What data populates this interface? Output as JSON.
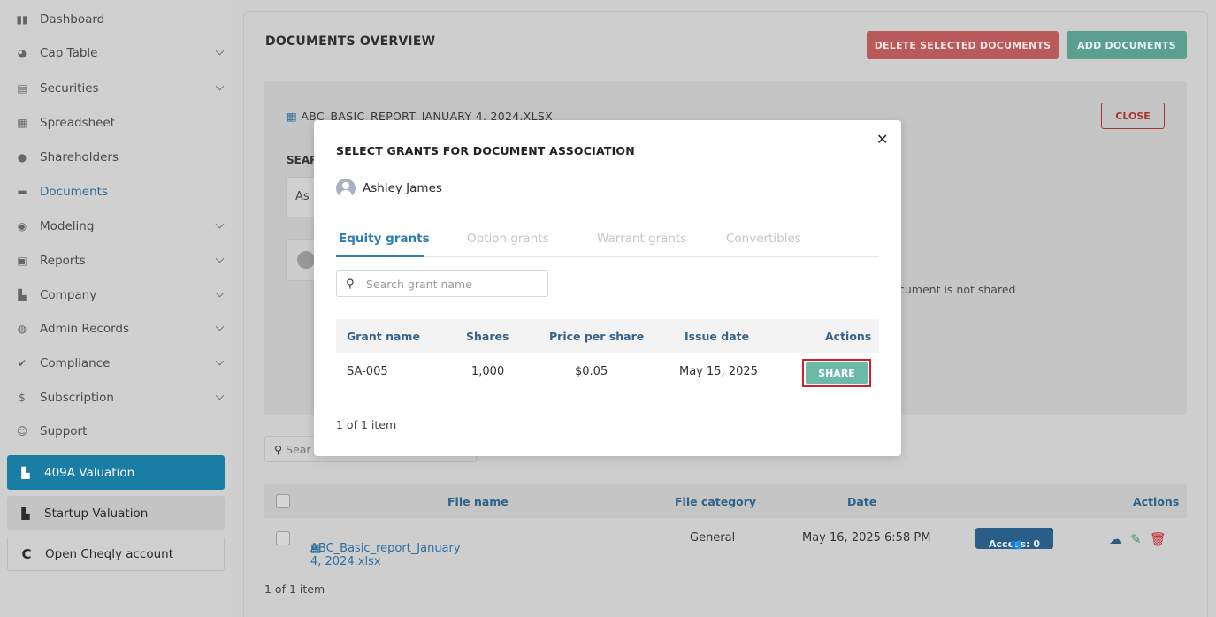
{
  "sidebar": {
    "items": [
      {
        "label": "Dashboard",
        "icon": "dashboard-icon"
      },
      {
        "label": "Cap Table",
        "icon": "pie-chart-icon"
      },
      {
        "label": "Securities",
        "icon": "clipboard-icon"
      },
      {
        "label": "Spreadsheet",
        "icon": "spreadsheet-icon"
      },
      {
        "label": "Shareholders",
        "icon": "user-icon"
      },
      {
        "label": "Documents",
        "icon": "folder-icon"
      },
      {
        "label": "Modeling",
        "icon": "lightbulb-icon"
      },
      {
        "label": "Reports",
        "icon": "report-icon"
      },
      {
        "label": "Company",
        "icon": "building-icon"
      },
      {
        "label": "Admin Records",
        "icon": "records-icon"
      },
      {
        "label": "Compliance",
        "icon": "check-shield-icon"
      },
      {
        "label": "Subscription",
        "icon": "dollar-icon"
      },
      {
        "label": "Support",
        "icon": "support-icon"
      }
    ],
    "valuation_409a": "409A Valuation",
    "startup_valuation": "Startup Valuation",
    "open_cheqly": "Open Cheqly account"
  },
  "main": {
    "title": "DOCUMENTS OVERVIEW",
    "delete_btn": "DELETE SELECTED DOCUMENTS",
    "add_btn": "ADD DOCUMENTS",
    "detail": {
      "file_name": "ABC_BASIC_REPORT_JANUARY 4, 2024.XLSX",
      "close_btn": "CLOSE",
      "search_label": "SEAR",
      "as_text": "As",
      "not_shared_text": "cument is not shared"
    },
    "search_placeholder": "Sear",
    "table": {
      "headers": {
        "file_name": "File name",
        "file_category": "File category",
        "date": "Date",
        "actions": "Actions"
      },
      "row": {
        "file_name": "ABC_Basic_report_January 4, 2024.xlsx",
        "category": "General",
        "date": "May 16, 2025 6:58 PM",
        "access": "Access: 0"
      }
    },
    "pager": "1 of 1 item"
  },
  "modal": {
    "title": "SELECT GRANTS FOR DOCUMENT ASSOCIATION",
    "user": "Ashley James",
    "tabs": [
      "Equity grants",
      "Option grants",
      "Warrant grants",
      "Convertibles"
    ],
    "search_placeholder": "Search grant name",
    "table": {
      "headers": {
        "grant_name": "Grant name",
        "shares": "Shares",
        "price": "Price per share",
        "issue_date": "Issue date",
        "actions": "Actions"
      },
      "row": {
        "grant_name": "SA-005",
        "shares": "1,000",
        "price": "$0.05",
        "issue_date": "May 15, 2025",
        "action": "SHARE"
      }
    },
    "pager": "1 of 1 item"
  },
  "colors": {
    "accent": "#2c7fb0",
    "share": "#6cb9a6",
    "highlight": "#d21f2f",
    "delete": "#b85a5a",
    "add": "#5b9f8e"
  }
}
